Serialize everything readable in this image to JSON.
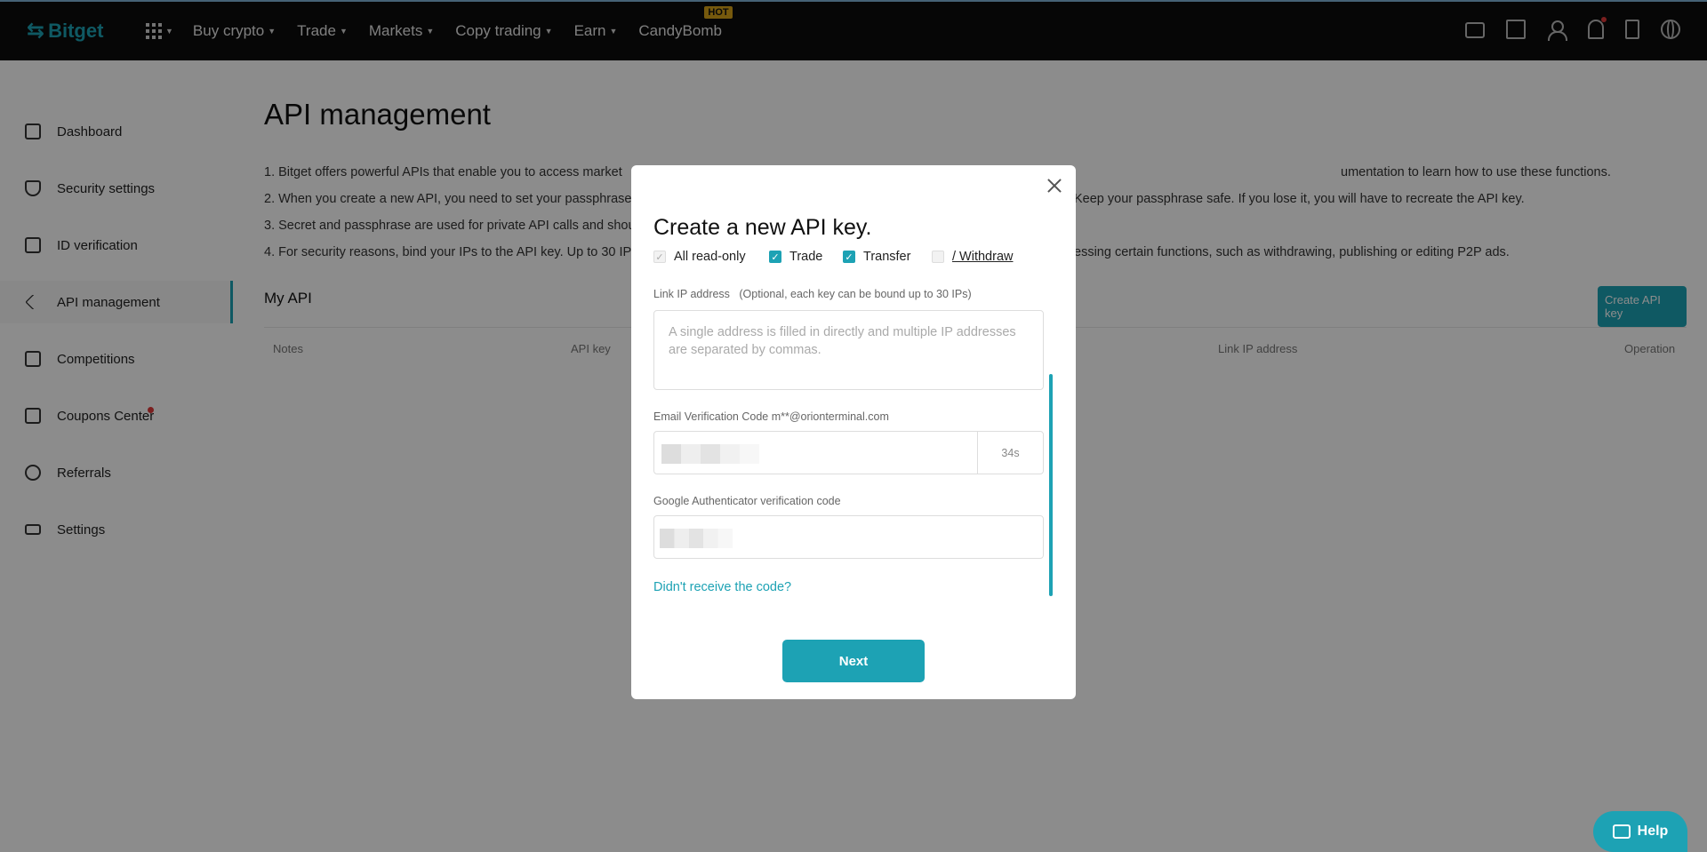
{
  "nav": {
    "logo": "Bitget",
    "items": [
      {
        "label": "Buy crypto"
      },
      {
        "label": "Trade"
      },
      {
        "label": "Markets"
      },
      {
        "label": "Copy trading"
      },
      {
        "label": "Earn"
      },
      {
        "label": "CandyBomb"
      }
    ],
    "hot_badge": "HOT"
  },
  "sidebar": {
    "items": [
      {
        "label": "Dashboard",
        "icon": "layers-icon"
      },
      {
        "label": "Security settings",
        "icon": "shield-icon"
      },
      {
        "label": "ID verification",
        "icon": "id-card-icon"
      },
      {
        "label": "API management",
        "icon": "api-icon"
      },
      {
        "label": "Competitions",
        "icon": "grid-icon"
      },
      {
        "label": "Coupons Center",
        "icon": "coupon-icon"
      },
      {
        "label": "Referrals",
        "icon": "referral-icon"
      },
      {
        "label": "Settings",
        "icon": "settings-sliders-icon"
      }
    ]
  },
  "main": {
    "title": "API management",
    "notes": [
      "1. Bitget offers powerful APIs that enable you to access market",
      "2. When you create a new API, you need to set your passphrase",
      "3. Secret and passphrase are used for private API calls and shou",
      "4. For security reasons, bind your IPs to the API key. Up to 30 IP"
    ],
    "notes_right": [
      "umentation to learn how to use these functions.",
      "Keep your passphrase safe. If you lose it, you will have to recreate the API key.",
      "",
      "essing certain functions, such as withdrawing, publishing or editing P2P ads."
    ],
    "my_api": "My API",
    "create_btn": "Create API key",
    "columns": [
      "Notes",
      "API key",
      "Link IP address",
      "Operation"
    ]
  },
  "modal": {
    "title": "Create a new API key.",
    "permissions": {
      "read_only": "All read-only",
      "trade": "Trade",
      "transfer": "Transfer",
      "withdraw": "/ Withdraw"
    },
    "ip_label": "Link IP address",
    "ip_hint": "(Optional, each key can be bound up to 30 IPs)",
    "ip_placeholder": "A single address is filled in directly and multiple IP addresses\nare separated by commas.",
    "email_label": "Email Verification Code m**@orionterminal.com",
    "timer": "34s",
    "ga_label": "Google Authenticator verification code",
    "didnt_receive": "Didn't receive the code?",
    "next": "Next"
  },
  "help": "Help",
  "colors": {
    "accent": "#1da2b4",
    "nav_bg": "#0b0b0b"
  }
}
